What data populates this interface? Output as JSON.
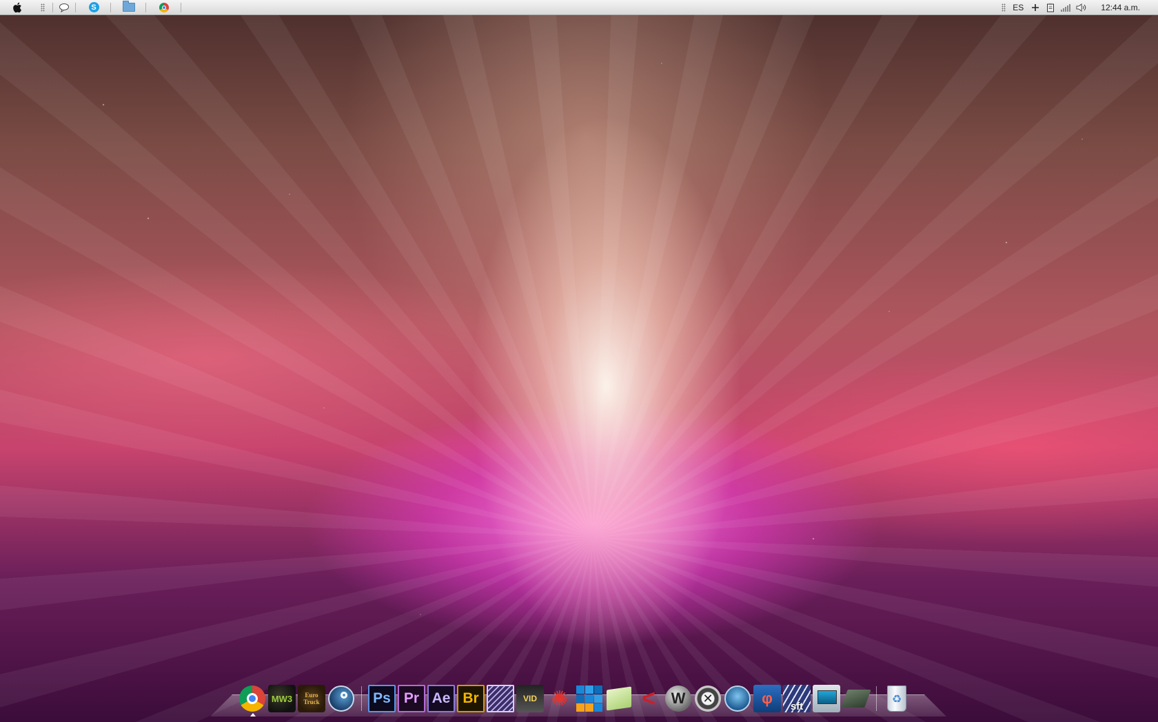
{
  "menubar": {
    "apple_icon": "apple-icon",
    "tabs": [
      {
        "name": "skype",
        "icon": "skype-icon",
        "glyph": "S"
      },
      {
        "name": "explorer",
        "icon": "folder-icon"
      },
      {
        "name": "chrome",
        "icon": "chrome-icon"
      }
    ],
    "status": {
      "language": "ES",
      "clock": "12:44 a.m."
    }
  },
  "dock": {
    "icons": [
      {
        "name": "chrome",
        "icon": "chrome-icon",
        "running": true
      },
      {
        "name": "modern-warfare-3",
        "icon": "game-icon",
        "label": "MW3"
      },
      {
        "name": "euro-truck-simulator",
        "icon": "truck-icon",
        "label": "Euro Truck"
      },
      {
        "name": "steam",
        "icon": "steam-icon"
      },
      {
        "name": "photoshop",
        "icon": "photoshop-icon",
        "label": "Ps"
      },
      {
        "name": "premiere",
        "icon": "premiere-icon",
        "label": "Pr"
      },
      {
        "name": "after-effects",
        "icon": "after-effects-icon",
        "label": "Ae"
      },
      {
        "name": "bridge",
        "icon": "bridge-icon",
        "label": "Br"
      },
      {
        "name": "media-encoder",
        "icon": "film-icon"
      },
      {
        "name": "video-converter",
        "icon": "clapper-icon",
        "label": "VID"
      },
      {
        "name": "red-app",
        "icon": "splash-icon"
      },
      {
        "name": "metro-tiles",
        "icon": "tiles-icon"
      },
      {
        "name": "notes",
        "icon": "paper-icon"
      },
      {
        "name": "cubase",
        "icon": "cubase-icon"
      },
      {
        "name": "waves",
        "icon": "waves-icon"
      },
      {
        "name": "x-circle",
        "icon": "circle-icon"
      },
      {
        "name": "dial",
        "icon": "dial-icon"
      },
      {
        "name": "vegas-pro",
        "icon": "vegas-icon"
      },
      {
        "name": "sft",
        "icon": "sft-icon",
        "label": "sft"
      },
      {
        "name": "system-monitor",
        "icon": "monitor-icon"
      },
      {
        "name": "memory",
        "icon": "ram-icon"
      },
      {
        "name": "recycle-bin",
        "icon": "trash-icon"
      }
    ]
  }
}
